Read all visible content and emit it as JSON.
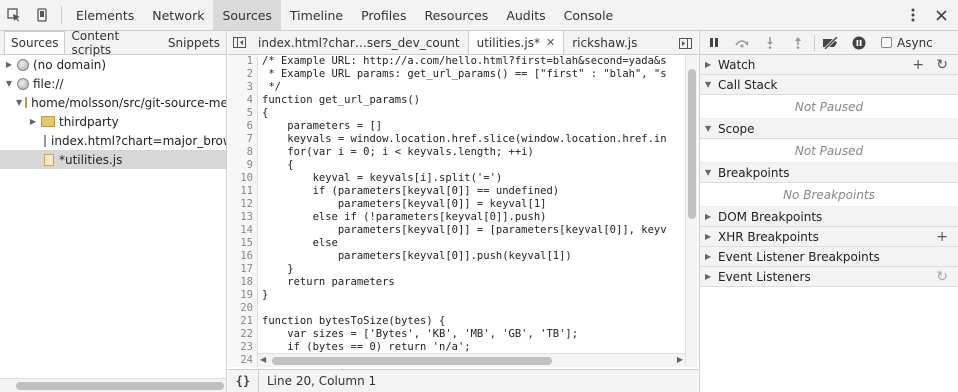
{
  "toolbar": {
    "tabs": [
      "Elements",
      "Network",
      "Sources",
      "Timeline",
      "Profiles",
      "Resources",
      "Audits",
      "Console"
    ],
    "active_tab": "Sources"
  },
  "navigator": {
    "tabs": [
      "Sources",
      "Content scripts",
      "Snippets"
    ],
    "tree": [
      {
        "label": "(no domain)"
      },
      {
        "label": "file://"
      },
      {
        "label": "home/molsson/src/git-source-me"
      },
      {
        "label": "thirdparty"
      },
      {
        "label": "index.html?chart=major_brows"
      },
      {
        "label": "*utilities.js"
      }
    ]
  },
  "editor": {
    "tabs": [
      {
        "label": "index.html?char…sers_dev_count"
      },
      {
        "label": "utilities.js*"
      },
      {
        "label": "rickshaw.js"
      }
    ],
    "line_numbers": [
      "1",
      "2",
      "3",
      "4",
      "5",
      "6",
      "7",
      "8",
      "9",
      "10",
      "11",
      "12",
      "13",
      "14",
      "15",
      "16",
      "17",
      "18",
      "19",
      "20",
      "21",
      "22",
      "23",
      "24"
    ],
    "code": [
      "/* Example URL: http://a.com/hello.html?first=blah&second=yada&s",
      " * Example URL params: get_url_params() == [\"first\" : \"blah\", \"s",
      " */",
      "function get_url_params()",
      "{",
      "    parameters = []",
      "    keyvals = window.location.href.slice(window.location.href.in",
      "    for(var i = 0; i < keyvals.length; ++i)",
      "    {",
      "        keyval = keyvals[i].split('=')",
      "        if (parameters[keyval[0]] == undefined)",
      "            parameters[keyval[0]] = keyval[1]",
      "        else if (!parameters[keyval[0]].push)",
      "            parameters[keyval[0]] = [parameters[keyval[0]], keyv",
      "        else",
      "            parameters[keyval[0]].push(keyval[1])",
      "    }",
      "    return parameters",
      "}",
      "",
      "function bytesToSize(bytes) {",
      "    var sizes = ['Bytes', 'KB', 'MB', 'GB', 'TB'];",
      "    if (bytes == 0) return 'n/a';",
      ""
    ],
    "status": "Line 20, Column 1",
    "braces": "{}"
  },
  "debugger": {
    "async_label": "Async",
    "sections": {
      "watch": "Watch",
      "call_stack": "Call Stack",
      "call_stack_empty": "Not Paused",
      "scope": "Scope",
      "scope_empty": "Not Paused",
      "breakpoints": "Breakpoints",
      "breakpoints_empty": "No Breakpoints",
      "dom_breakpoints": "DOM Breakpoints",
      "xhr_breakpoints": "XHR Breakpoints",
      "event_listener_breakpoints": "Event Listener Breakpoints",
      "event_listeners": "Event Listeners"
    }
  }
}
